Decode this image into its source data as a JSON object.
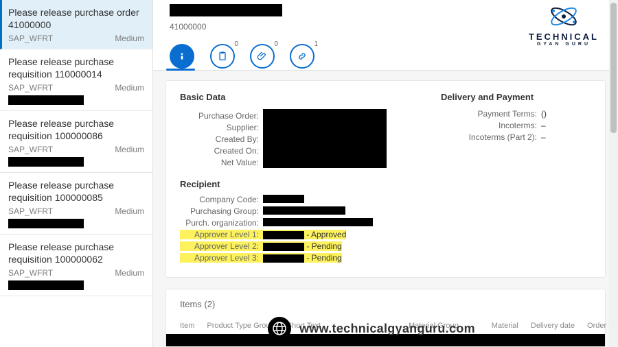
{
  "tasks": [
    {
      "title": "Please release purchase order 41000000",
      "source": "SAP_WFRT",
      "priority": "Medium",
      "selected": true
    },
    {
      "title": "Please release purchase requisition 110000014",
      "source": "SAP_WFRT",
      "priority": "Medium",
      "selected": false
    },
    {
      "title": "Please release purchase requisition 100000086",
      "source": "SAP_WFRT",
      "priority": "Medium",
      "selected": false
    },
    {
      "title": "Please release purchase requisition 100000085",
      "source": "SAP_WFRT",
      "priority": "Medium",
      "selected": false
    },
    {
      "title": "Please release purchase requisition 100000062",
      "source": "SAP_WFRT",
      "priority": "Medium",
      "selected": false
    }
  ],
  "header": {
    "po_number": "41000000"
  },
  "tabs": {
    "info_badge": "",
    "notes_badge": "0",
    "attach_badge": "0",
    "link_badge": "1"
  },
  "basic": {
    "section_title": "Basic Data",
    "labels": {
      "po": "Purchase Order:",
      "supplier": "Supplier:",
      "created_by": "Created By:",
      "created_on": "Created On:",
      "net": "Net Value:"
    }
  },
  "delivery": {
    "section_title": "Delivery and Payment",
    "payment_terms_label": "Payment Terms:",
    "payment_terms_value": "()",
    "incoterms_label": "Incoterms:",
    "incoterms_value": "–",
    "incoterms2_label": "Incoterms (Part 2):",
    "incoterms2_value": "–"
  },
  "recipient": {
    "section_title": "Recipient",
    "company_label": "Company Code:",
    "pgroup_label": "Purchasing Group:",
    "porg_label": "Purch. organization:",
    "a1_label": "Approver Level 1:",
    "a1_status": "- Approved",
    "a2_label": "Approver Level 2:",
    "a2_status": "- Pending",
    "a3_label": "Approver Level 3:",
    "a3_status": "- Pending"
  },
  "items": {
    "title": "Items (2)",
    "cols": {
      "c1": "Item",
      "c2": "Product Type Group",
      "c3": "Short Text",
      "c4": "Material Group",
      "c5": "Material",
      "c6": "Delivery date",
      "c7": "Order Quantity"
    }
  },
  "branding": {
    "name": "TECHNICAL",
    "sub": "GYAN GURU",
    "url": "www.technicalgyanguru.com"
  }
}
